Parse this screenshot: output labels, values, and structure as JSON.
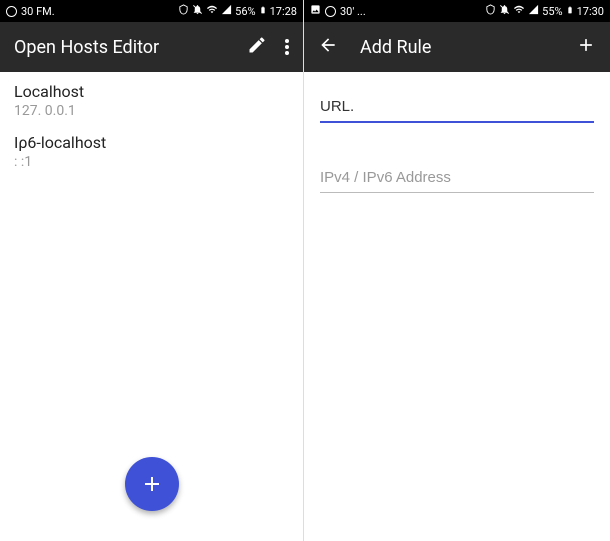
{
  "left": {
    "status": {
      "left_text": "30 FM.",
      "battery": "56%",
      "time": "17:28"
    },
    "appbar": {
      "title": "Open Hosts Editor"
    },
    "hosts": [
      {
        "name": "Localhost",
        "ip": "127. 0.0.1"
      },
      {
        "name": "Iρ6-localhost",
        "ip": ": :1"
      }
    ]
  },
  "right": {
    "status": {
      "left_text": "30' ...",
      "battery": "55%",
      "time": "17:30"
    },
    "appbar": {
      "title": "Add Rule"
    },
    "form": {
      "url_value": "URL.",
      "url_placeholder": "URL",
      "address_placeholder": "IPv4 / IPv6 Address"
    }
  }
}
